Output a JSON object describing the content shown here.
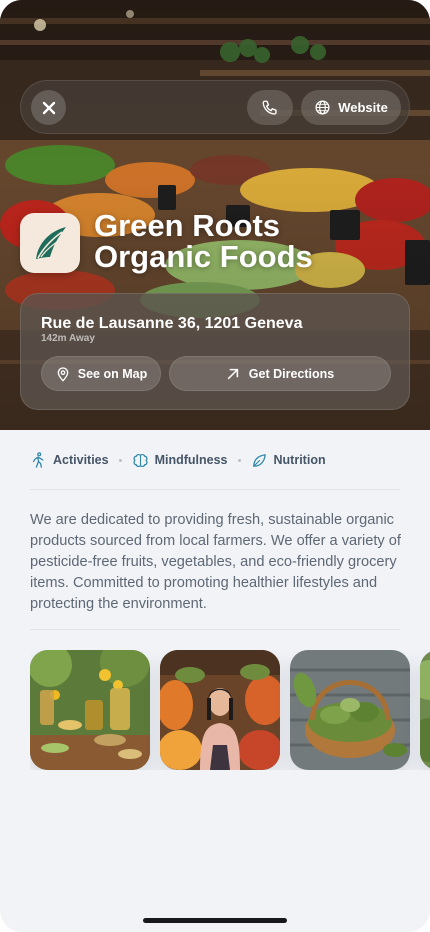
{
  "header": {
    "website_label": "Website"
  },
  "business": {
    "name_line1": "Green Roots",
    "name_line2": "Organic Foods",
    "address": "Rue de Lausanne 36, 1201 Geneva",
    "distance": "142m Away",
    "see_on_map_label": "See on Map",
    "directions_label": "Get Directions"
  },
  "tags": [
    {
      "label": "Activities",
      "icon": "person-walking-icon"
    },
    {
      "label": "Mindfulness",
      "icon": "brain-icon"
    },
    {
      "label": "Nutrition",
      "icon": "leaf-icon"
    }
  ],
  "description": "We are dedicated to providing fresh, sustainable organic products sourced from local farmers. We offer a variety of pesticide-free fruits, vegetables, and eco-friendly grocery items. Committed to promoting healthier lifestyles and protecting the environment.",
  "gallery": [
    {
      "name": "gallery-photo-oils-herbs"
    },
    {
      "name": "gallery-photo-vendor"
    },
    {
      "name": "gallery-photo-herb-basket"
    },
    {
      "name": "gallery-photo-partial"
    }
  ],
  "colors": {
    "accent": "#2f86a8",
    "text_dark": "#465567",
    "text_body": "#5e6875",
    "logo_bg": "#f5e8dc",
    "logo_green": "#1f6d5b"
  }
}
